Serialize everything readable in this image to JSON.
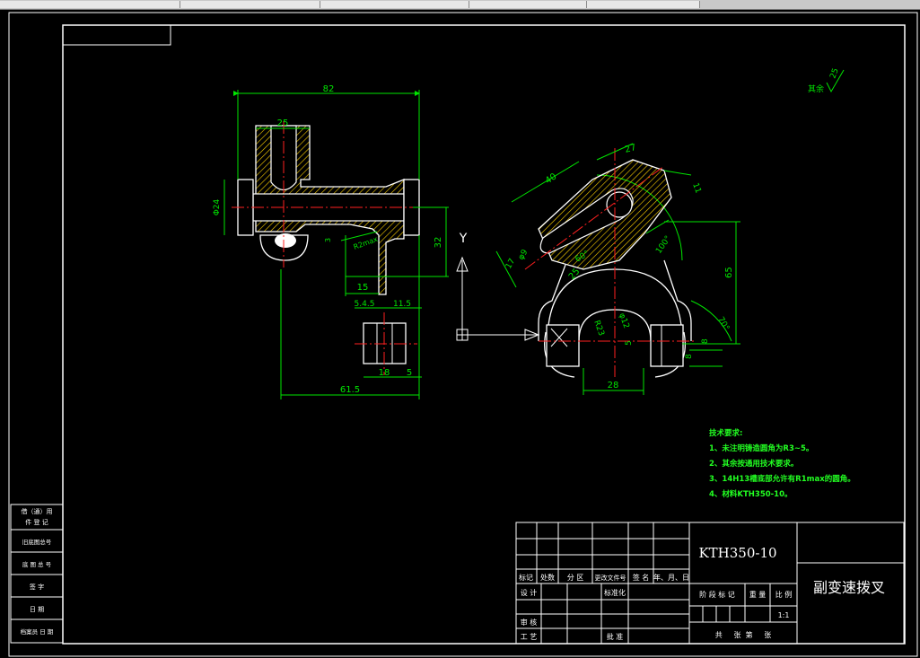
{
  "colors": {
    "outline": "#ffffff",
    "dimension": "#00e600",
    "centerline": "#ff2020",
    "hatch": "#ffd200",
    "notes": "#22ff22"
  },
  "dims": {
    "d82": "82",
    "d25": "25",
    "phi24": "Φ24",
    "r2max": "R2max",
    "d3": "3",
    "d32": "32",
    "d15": "15",
    "d5_4": "5.4.5",
    "d11_5": "11.5",
    "d18": "18",
    "d5": "5",
    "d61_5": "61.5",
    "d27": "27",
    "d40": "40",
    "d11": "11",
    "d17": "17",
    "d9": "φ9",
    "d60": "60°",
    "d25b": "25",
    "d100": "100°",
    "d65": "65",
    "r23": "R23",
    "phi2": "φ12",
    "d5b": "5",
    "d28": "28",
    "d70": "70°",
    "d8a": "8",
    "d8b": "8"
  },
  "axes": {
    "y": "Y"
  },
  "roughness": {
    "text": "其余",
    "value": "25"
  },
  "notes": {
    "title": "技术要求:",
    "items": [
      "1、未注明铸造圆角为R3~5。",
      "2、其余按通用技术要求。",
      "3、14H13槽底部允许有R1max的圆角。",
      "4、材料KTH350-10。"
    ]
  },
  "titleblock": {
    "material": "KTH350-10",
    "name": "副变速拨叉",
    "scale": "1:1",
    "header": [
      "标记",
      "处数",
      "分 区",
      "更改文件号",
      "签 名",
      "年、月、日"
    ],
    "row_design": "设 计",
    "row_standard": "标准化",
    "stage": "阶 段 标 记",
    "weight": "重 量",
    "ratio": "比 例",
    "review": "审 核",
    "process": "工 艺",
    "approve": "批 准",
    "sheets": "共     张  第     张"
  },
  "sidebar": [
    "借（通）用",
    "件 登 记",
    "旧底图总号",
    "底 图 总 号",
    "签    字",
    "日    期",
    "档案员 日 期"
  ]
}
